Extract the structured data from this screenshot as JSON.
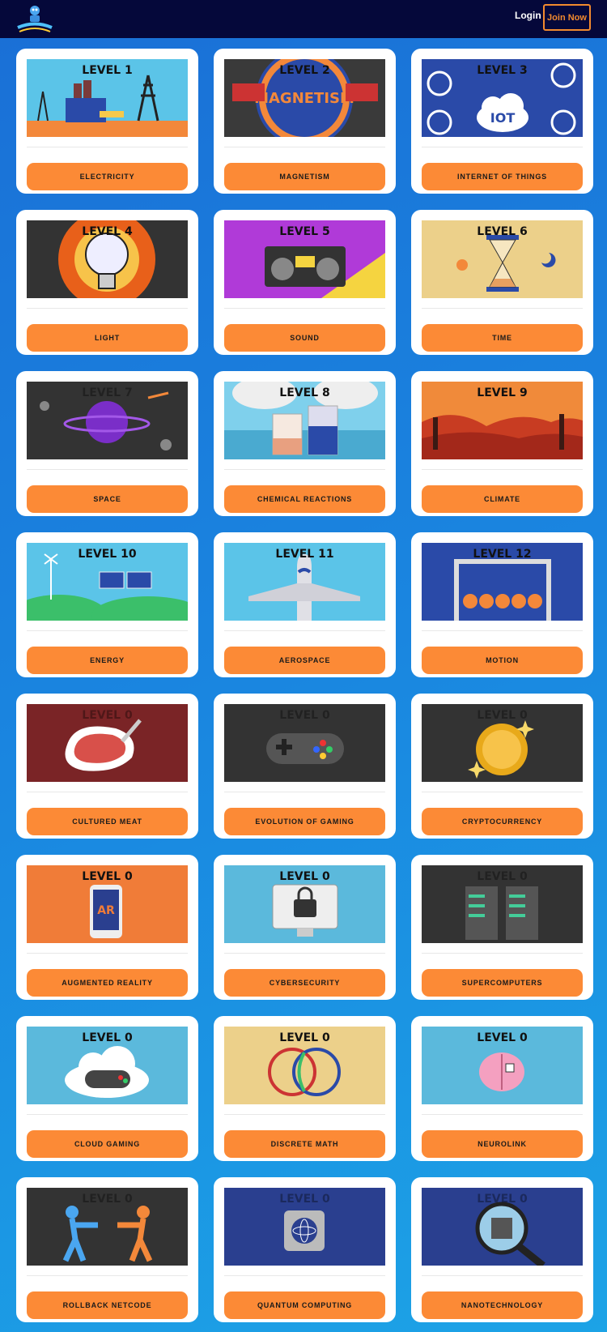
{
  "header": {
    "login_label": "Login",
    "join_label": "Join Now"
  },
  "colors": {
    "topbar": "#05083a",
    "button": "#fc8a36",
    "accent": "#f28a2e"
  },
  "cards": [
    {
      "level": "LEVEL 1",
      "label": "ELECTRICITY",
      "icon": "electricity-icon",
      "bg": "#5bc4e8",
      "star": true
    },
    {
      "level": "LEVEL 2",
      "label": "MAGNETISM",
      "icon": "magnet-icon",
      "bg": "#3a3a3a",
      "star": true
    },
    {
      "level": "LEVEL 3",
      "label": "INTERNET OF THINGS",
      "icon": "iot-icon",
      "bg": "#2a4aa8",
      "star": true
    },
    {
      "level": "LEVEL 4",
      "label": "LIGHT",
      "icon": "lightbulb-icon",
      "bg": "#333",
      "star": true
    },
    {
      "level": "LEVEL 5",
      "label": "SOUND",
      "icon": "boombox-icon",
      "bg": "#b03ad8",
      "star": true
    },
    {
      "level": "LEVEL 6",
      "label": "TIME",
      "icon": "hourglass-icon",
      "bg": "#ecd08a",
      "star": true
    },
    {
      "level": "LEVEL 7",
      "label": "SPACE",
      "icon": "planet-icon",
      "bg": "#333",
      "star": true,
      "dim": true
    },
    {
      "level": "LEVEL 8",
      "label": "CHEMICAL REACTIONS",
      "icon": "beaker-icon",
      "bg": "#7fd0ec",
      "star": true
    },
    {
      "level": "LEVEL 9",
      "label": "CLIMATE",
      "icon": "desert-icon",
      "bg": "#e8602a",
      "star": true
    },
    {
      "level": "LEVEL 10",
      "label": "ENERGY",
      "icon": "solar-panel-icon",
      "bg": "#5bc4e8",
      "star": true
    },
    {
      "level": "LEVEL 11",
      "label": "AEROSPACE",
      "icon": "airplane-icon",
      "bg": "#5bc4e8",
      "star": true
    },
    {
      "level": "LEVEL 12",
      "label": "MOTION",
      "icon": "newtons-cradle-icon",
      "bg": "#2a4aa8",
      "star": true
    },
    {
      "level": "LEVEL 0",
      "label": "CULTURED MEAT",
      "icon": "meat-icon",
      "bg": "#7a2426",
      "star": false,
      "dim": true
    },
    {
      "level": "LEVEL 0",
      "label": "EVOLUTION OF GAMING",
      "icon": "gamepad-icon",
      "bg": "#333",
      "star": false,
      "dim": true
    },
    {
      "level": "LEVEL 0",
      "label": "CRYPTOCURRENCY",
      "icon": "coin-icon",
      "bg": "#333",
      "star": false,
      "dim": true
    },
    {
      "level": "LEVEL 0",
      "label": "AUGMENTED REALITY",
      "icon": "ar-phone-icon",
      "bg": "#f07c38",
      "star": false
    },
    {
      "level": "LEVEL 0",
      "label": "CYBERSECURITY",
      "icon": "lock-monitor-icon",
      "bg": "#5bb9dc",
      "star": false
    },
    {
      "level": "LEVEL 0",
      "label": "SUPERCOMPUTERS",
      "icon": "server-icon",
      "bg": "#333",
      "star": false,
      "dim": true
    },
    {
      "level": "LEVEL 0",
      "label": "CLOUD GAMING",
      "icon": "cloud-gamepad-icon",
      "bg": "#5bb9dc",
      "star": false
    },
    {
      "level": "LEVEL 0",
      "label": "DISCRETE MATH",
      "icon": "venn-icon",
      "bg": "#ecd08a",
      "star": false
    },
    {
      "level": "LEVEL 0",
      "label": "NEUROLINK",
      "icon": "brain-icon",
      "bg": "#5bb9dc",
      "star": false
    },
    {
      "level": "LEVEL 0",
      "label": "ROLLBACK NETCODE",
      "icon": "fighters-icon",
      "bg": "#333",
      "star": false,
      "dim": true
    },
    {
      "level": "LEVEL 0",
      "label": "QUANTUM COMPUTING",
      "icon": "quantum-chip-icon",
      "bg": "#2a3f8f",
      "star": false,
      "dim": true
    },
    {
      "level": "LEVEL 0",
      "label": "NANOTECHNOLOGY",
      "icon": "magnifier-chip-icon",
      "bg": "#2a3f8f",
      "star": false,
      "dim": true
    }
  ]
}
